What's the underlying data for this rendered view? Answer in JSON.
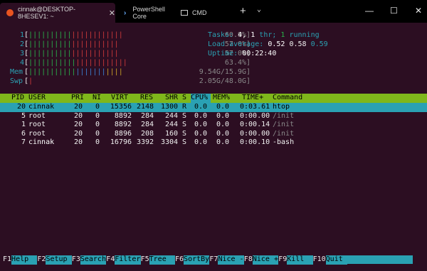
{
  "tabs": [
    {
      "label": "cinnak@DESKTOP-8HESEV1: ~",
      "icon": "ubuntu-icon",
      "active": true
    },
    {
      "label": "PowerShell Core",
      "icon": "powershell-icon",
      "active": false
    },
    {
      "label": "CMD",
      "icon": "cmd-icon",
      "active": false
    }
  ],
  "tab_close_glyph": "✕",
  "new_tab_glyph": "+",
  "dropdown_glyph": "⌄",
  "window_controls": {
    "minimize": "—",
    "maximize": "☐",
    "close": "✕"
  },
  "meters": [
    {
      "label": "1",
      "value": "60.9%]",
      "fill": 0.609
    },
    {
      "label": "2",
      "value": "57.0%]",
      "fill": 0.57
    },
    {
      "label": "3",
      "value": "57.0%]",
      "fill": 0.57
    },
    {
      "label": "4",
      "value": "63.4%]",
      "fill": 0.634
    },
    {
      "label": "Mem",
      "value": "9.54G/15.9G]",
      "fill": 0.6
    },
    {
      "label": "Swp",
      "value": "2.05G/48.0G]",
      "fill": 0.04
    }
  ],
  "stats": {
    "tasks_label": "Tasks:",
    "tasks_count": "4,",
    "thr_count": "1",
    "thr_label": "thr;",
    "running_count": "1",
    "running_label": "running",
    "load_label": "Load average:",
    "load1": "0.52",
    "load5": "0.58",
    "load15": "0.59",
    "uptime_label": "Uptime:",
    "uptime_value": "00:22:40"
  },
  "columns": [
    "PID",
    "USER",
    "PRI",
    "NI",
    "VIRT",
    "RES",
    "SHR",
    "S",
    "CPU%",
    "MEM%",
    "TIME+",
    "Command"
  ],
  "processes": [
    {
      "pid": "20",
      "user": "cinnak",
      "pri": "20",
      "ni": "0",
      "virt": "15356",
      "res": "2148",
      "shr": "1300",
      "s": "R",
      "cpu": "0.0",
      "mem": "0.0",
      "time": "0:03.61",
      "command": "htop",
      "selected": true
    },
    {
      "pid": "5",
      "user": "root",
      "pri": "20",
      "ni": "0",
      "virt": "8892",
      "res": "284",
      "shr": "244",
      "s": "S",
      "cpu": "0.0",
      "mem": "0.0",
      "time": "0:00.00",
      "command": "/init"
    },
    {
      "pid": "1",
      "user": "root",
      "pri": "20",
      "ni": "0",
      "virt": "8892",
      "res": "284",
      "shr": "244",
      "s": "S",
      "cpu": "0.0",
      "mem": "0.0",
      "time": "0:00.14",
      "command": "/init"
    },
    {
      "pid": "6",
      "user": "root",
      "pri": "20",
      "ni": "0",
      "virt": "8896",
      "res": "208",
      "shr": "160",
      "s": "S",
      "cpu": "0.0",
      "mem": "0.0",
      "time": "0:00.00",
      "command": "/init"
    },
    {
      "pid": "7",
      "user": "cinnak",
      "pri": "20",
      "ni": "0",
      "virt": "16796",
      "res": "3392",
      "shr": "3304",
      "s": "S",
      "cpu": "0.0",
      "mem": "0.0",
      "time": "0:00.10",
      "command": "-bash"
    }
  ],
  "fkeys": [
    {
      "key": "F1",
      "label": "Help  "
    },
    {
      "key": "F2",
      "label": "Setup "
    },
    {
      "key": "F3",
      "label": "Search"
    },
    {
      "key": "F4",
      "label": "Filter"
    },
    {
      "key": "F5",
      "label": "Tree  "
    },
    {
      "key": "F6",
      "label": "SortBy"
    },
    {
      "key": "F7",
      "label": "Nice -"
    },
    {
      "key": "F8",
      "label": "Nice +"
    },
    {
      "key": "F9",
      "label": "Kill  "
    },
    {
      "key": "F10",
      "label": "Quit"
    }
  ],
  "colors": {
    "background": "#2c0e22",
    "accent_cyan": "#2aa1b3",
    "header_green": "#7fb71b",
    "bar_red": "#cf3a3a",
    "bar_green": "#29b34a"
  }
}
